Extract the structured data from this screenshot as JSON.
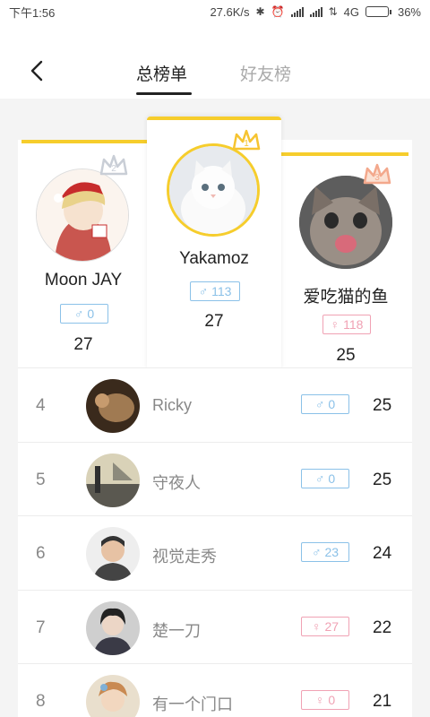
{
  "status_bar": {
    "time": "下午1:56",
    "net_speed": "27.6K/s",
    "network": "4G",
    "battery": "36%",
    "battery_level": 0.36
  },
  "header": {
    "tabs": [
      {
        "label": "总榜单",
        "active": true
      },
      {
        "label": "好友榜",
        "active": false
      }
    ]
  },
  "podium": [
    {
      "rank": 1,
      "name": "Yakamoz",
      "gender": "male",
      "badge_value": "113",
      "score": "27",
      "crown_color": "#f6c431"
    },
    {
      "rank": 2,
      "name": "Moon JAY",
      "gender": "male",
      "badge_value": "0",
      "score": "27",
      "crown_color": "#c9ced6"
    },
    {
      "rank": 3,
      "name": "爱吃猫的鱼",
      "gender": "female",
      "badge_value": "118",
      "score": "25",
      "crown_color": "#f3a88c"
    }
  ],
  "rows": [
    {
      "rank": "4",
      "name": "Ricky",
      "gender": "male",
      "badge_value": "0",
      "score": "25"
    },
    {
      "rank": "5",
      "name": "守夜人",
      "gender": "male",
      "badge_value": "0",
      "score": "25"
    },
    {
      "rank": "6",
      "name": "视觉走秀",
      "gender": "male",
      "badge_value": "23",
      "score": "24"
    },
    {
      "rank": "7",
      "name": "楚一刀",
      "gender": "female",
      "badge_value": "27",
      "score": "22"
    },
    {
      "rank": "8",
      "name": "有一个门口",
      "gender": "female",
      "badge_value": "0",
      "score": "21"
    }
  ],
  "colors": {
    "accent": "#f6cd2c",
    "male": "#8bc1e8",
    "female": "#f0a2b4"
  }
}
